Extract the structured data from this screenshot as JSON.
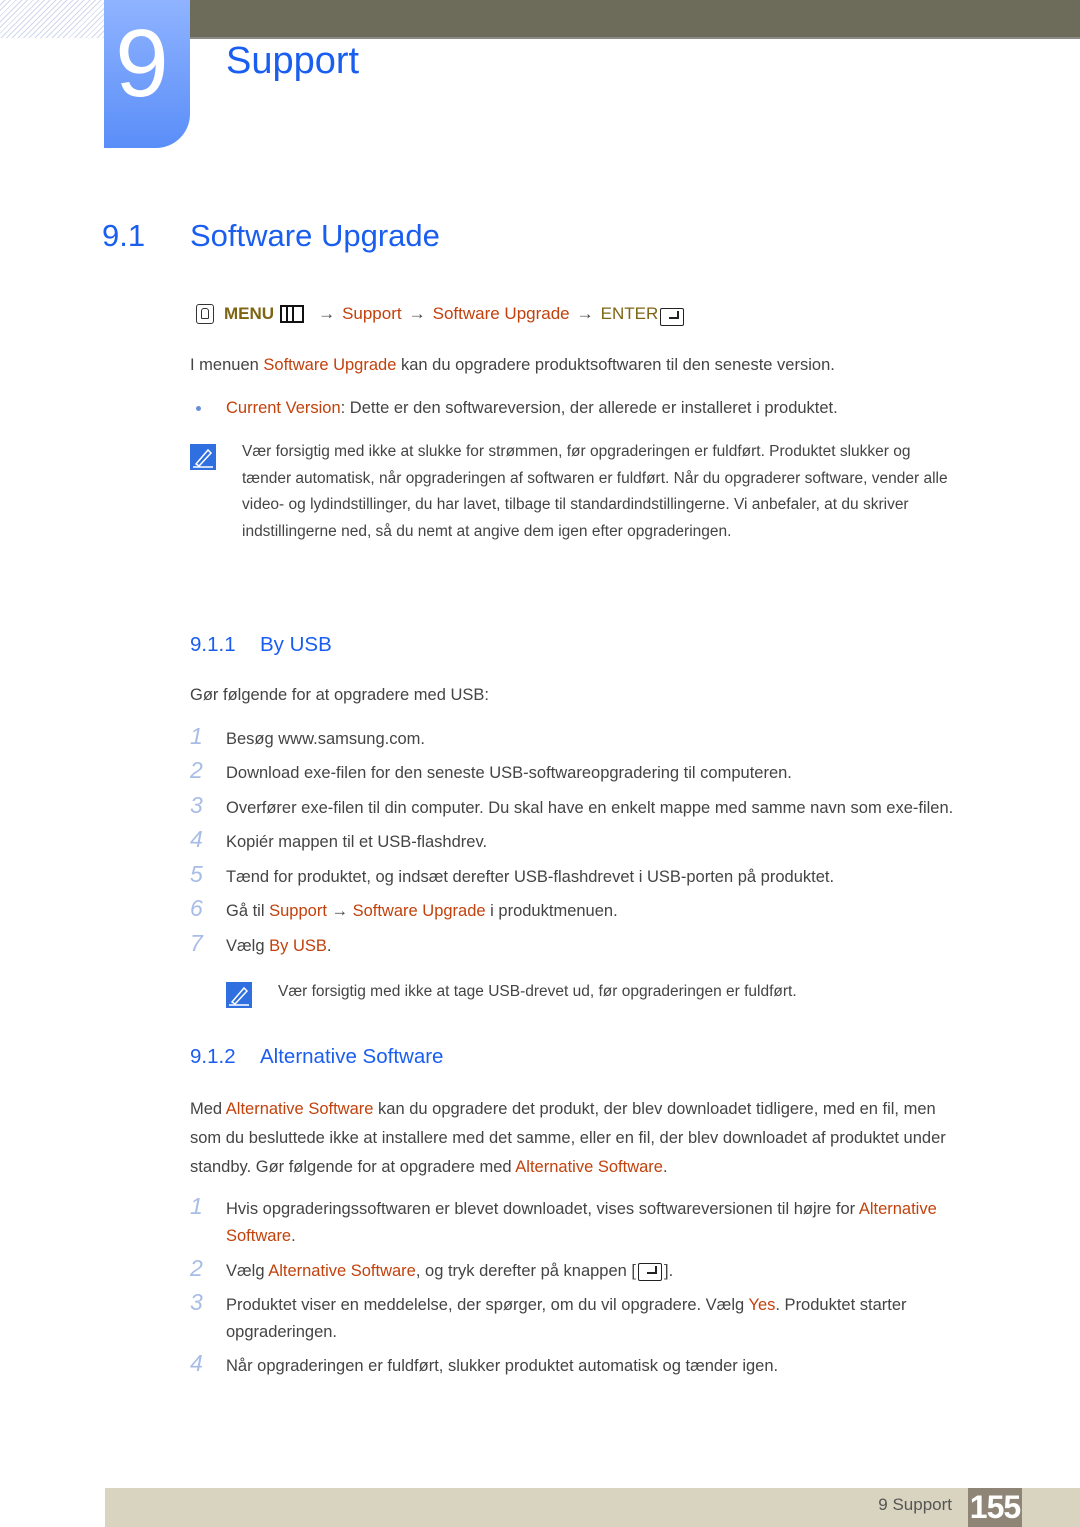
{
  "header": {
    "chapter_number": "9",
    "chapter_title": "Support"
  },
  "section": {
    "number": "9.1",
    "title": "Software Upgrade"
  },
  "nav_path": {
    "menu_label": "MENU",
    "arrow": "→",
    "item1": "Support",
    "item2": "Software Upgrade",
    "enter_label": "ENTER"
  },
  "intro": {
    "prefix": "I menuen ",
    "highlight": "Software Upgrade",
    "suffix": " kan du opgradere produktsoftwaren til den seneste version."
  },
  "bullet": {
    "term": "Current Version",
    "text": ": Dette er den softwareversion, der allerede er installeret i produktet."
  },
  "note1": {
    "line1": "Vær forsigtig med ikke at slukke for strømmen, før opgraderingen er fuldført. Produktet slukker og",
    "line2": "tænder automatisk, når opgraderingen af softwaren er fuldført. Når du opgraderer software, vender alle",
    "line3": "video- og lydindstillinger, du har lavet, tilbage til standardindstillingerne. Vi anbefaler, at du skriver",
    "line4": "indstillingerne ned, så du nemt at angive dem igen efter opgraderingen."
  },
  "sub1": {
    "number": "9.1.1",
    "title": "By USB",
    "intro": "Gør følgende for at opgradere med USB:",
    "steps": [
      {
        "n": "1",
        "text": "Besøg www.samsung.com."
      },
      {
        "n": "2",
        "text": "Download exe-filen for den seneste USB-softwareopgradering til computeren."
      },
      {
        "n": "3",
        "text": "Overfører exe-filen til din computer. Du skal have en enkelt mappe med samme navn som exe-filen."
      },
      {
        "n": "4",
        "text": "Kopiér mappen til et USB-flashdrev."
      },
      {
        "n": "5",
        "text": "Tænd for produktet, og indsæt derefter USB-flashdrevet i USB-porten på produktet."
      },
      {
        "n": "6",
        "pre": "Gå til ",
        "hl1": "Support",
        "arrow": " → ",
        "hl2": "Software Upgrade",
        "post": " i produktmenuen."
      },
      {
        "n": "7",
        "pre": "Vælg ",
        "hl1": "By USB",
        "post": "."
      }
    ],
    "note": "Vær forsigtig med ikke at tage USB-drevet ud, før opgraderingen er fuldført."
  },
  "sub2": {
    "number": "9.1.2",
    "title": "Alternative Software",
    "para": {
      "pre": "Med ",
      "hl1": "Alternative Software",
      "mid1": " kan du opgradere det produkt, der blev downloadet tidligere, med en fil, men",
      "line2": "som du besluttede ikke at installere med det samme, eller en fil, der blev downloadet af produktet under",
      "line3_pre": "standby. Gør følgende for at opgradere med ",
      "hl2": "Alternative Software",
      "line3_post": "."
    },
    "steps": [
      {
        "n": "1",
        "pre": "Hvis opgraderingssoftwaren er blevet downloadet, vises softwareversionen til højre for ",
        "hl1": "Alternative",
        "hl1b": "Software",
        "post": "."
      },
      {
        "n": "2",
        "pre": "Vælg ",
        "hl1": "Alternative Software",
        "mid": ", og tryk derefter på knappen [",
        "post": "]."
      },
      {
        "n": "3",
        "pre": "Produktet viser en meddelelse, der spørger, om du vil opgradere. Vælg ",
        "hl1": "Yes",
        "post": ". Produktet starter",
        "line2": "opgraderingen."
      },
      {
        "n": "4",
        "text": "Når opgraderingen er fuldført, slukker produktet automatisk og tænder igen."
      }
    ]
  },
  "footer": {
    "label": "9 Support",
    "page": "155"
  },
  "colors": {
    "heading_blue": "#1a5ef0",
    "highlight_red": "#c2410c",
    "menu_olive": "#7d6513",
    "footer_bg": "#d9d4c0",
    "page_box": "#8f8577"
  }
}
